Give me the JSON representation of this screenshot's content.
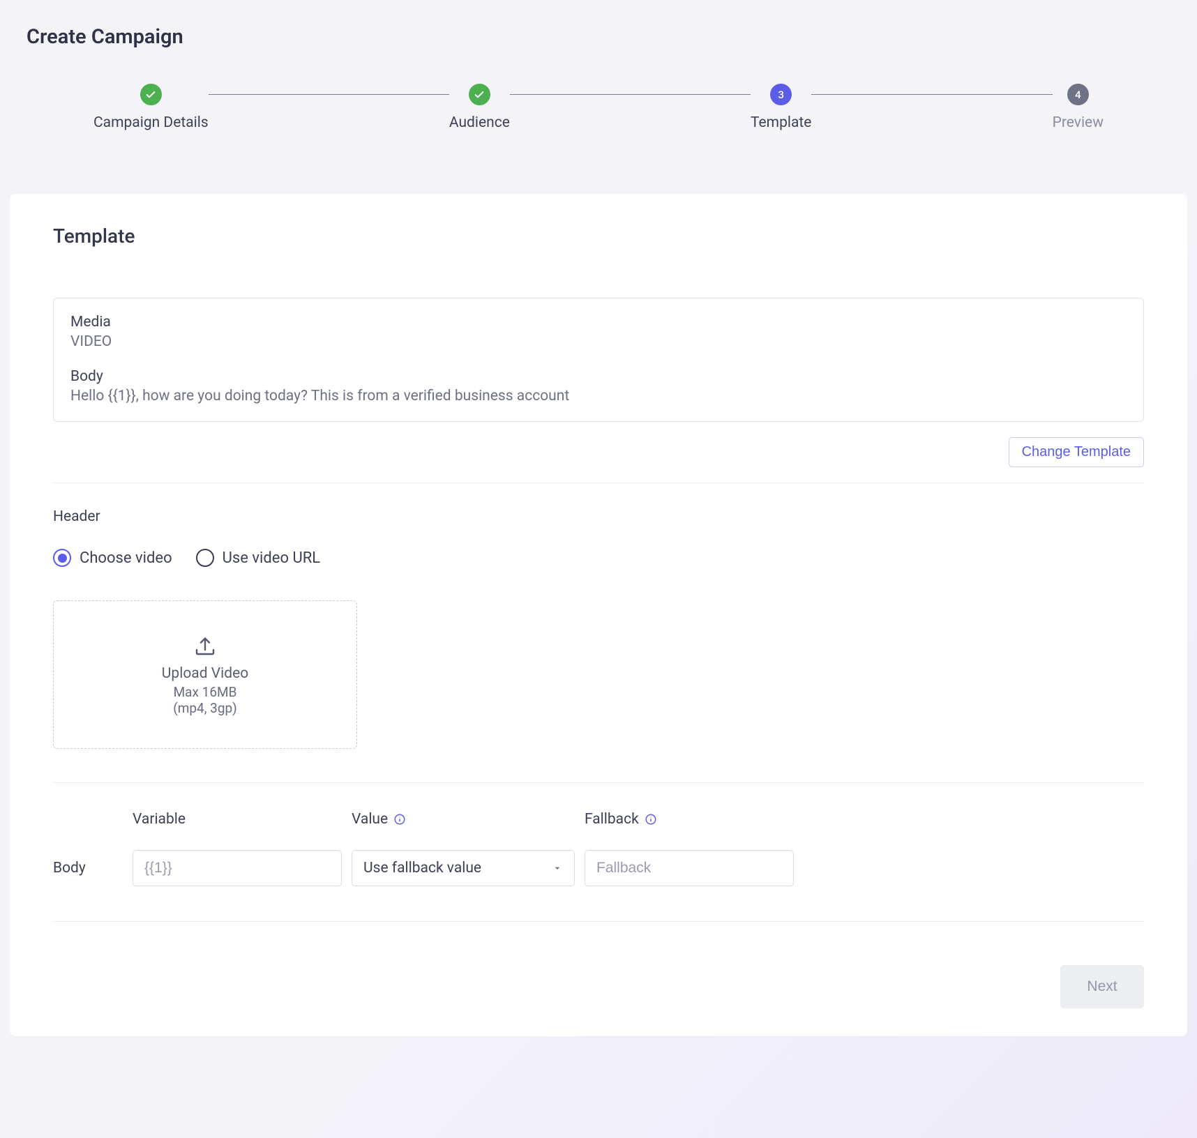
{
  "page": {
    "title": "Create Campaign"
  },
  "stepper": {
    "steps": [
      {
        "label": "Campaign Details",
        "state": "done"
      },
      {
        "label": "Audience",
        "state": "done"
      },
      {
        "label": "Template",
        "state": "active",
        "num": "3"
      },
      {
        "label": "Preview",
        "state": "upcoming",
        "num": "4"
      }
    ]
  },
  "card": {
    "title": "Template",
    "preview": {
      "media_label": "Media",
      "media_value": "VIDEO",
      "body_label": "Body",
      "body_value": "Hello {{1}}, how are you doing today? This is from a verified business account"
    },
    "change_button": "Change Template",
    "header": {
      "label": "Header",
      "options": {
        "choose": "Choose video",
        "url": "Use video URL"
      },
      "selected": "choose",
      "upload": {
        "title": "Upload Video",
        "max": "Max 16MB",
        "formats": "(mp4, 3gp)"
      }
    },
    "body_table": {
      "row_label": "Body",
      "headers": {
        "variable": "Variable",
        "value": "Value",
        "fallback": "Fallback"
      },
      "row": {
        "variable": "{{1}}",
        "value_select": "Use fallback value",
        "fallback_placeholder": "Fallback"
      }
    },
    "next_button": "Next"
  }
}
